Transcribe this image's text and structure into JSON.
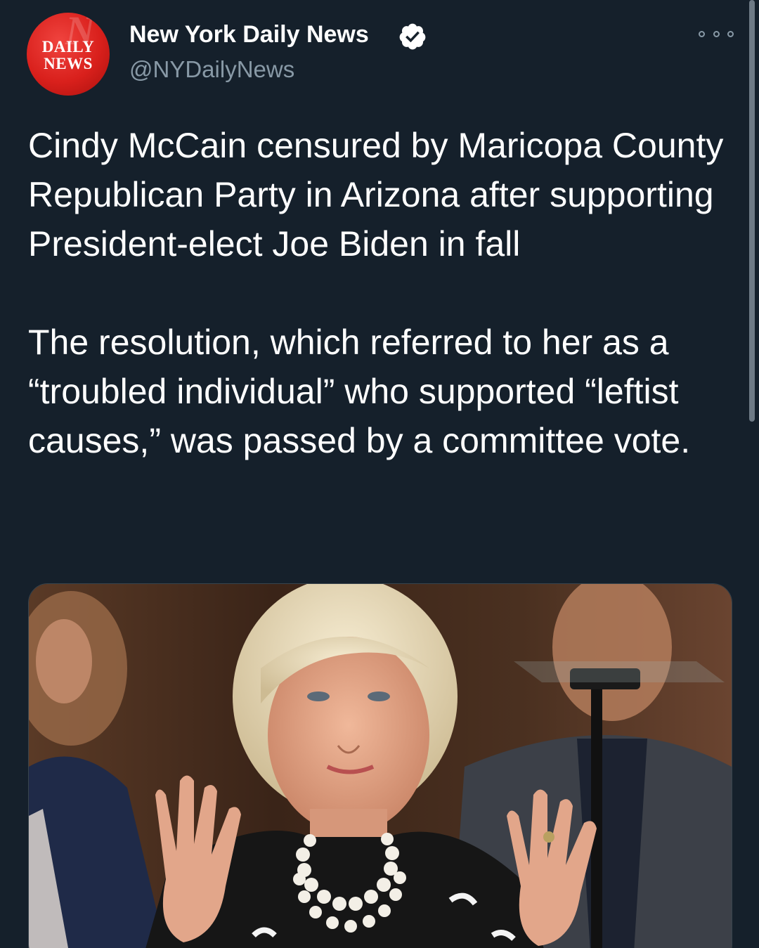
{
  "author": {
    "avatar_text": [
      "DAILY",
      "NEWS"
    ],
    "name": "New York Daily News",
    "handle": "@NYDailyNews",
    "verified": true
  },
  "actions": {
    "more_icon": "more-options-icon"
  },
  "tweet": {
    "paragraphs": [
      "Cindy McCain censured by Maricopa County Republican Party in Arizona after supporting President-elect Joe Biden in fall",
      "The resolution, which referred to her as a “troubled individual” who supported “leftist causes,” was passed by a committee vote."
    ]
  },
  "colors": {
    "background": "#15202b",
    "secondary_text": "#8899a6",
    "verified_badge": "#ffffff",
    "avatar_red": "#d9201c"
  }
}
